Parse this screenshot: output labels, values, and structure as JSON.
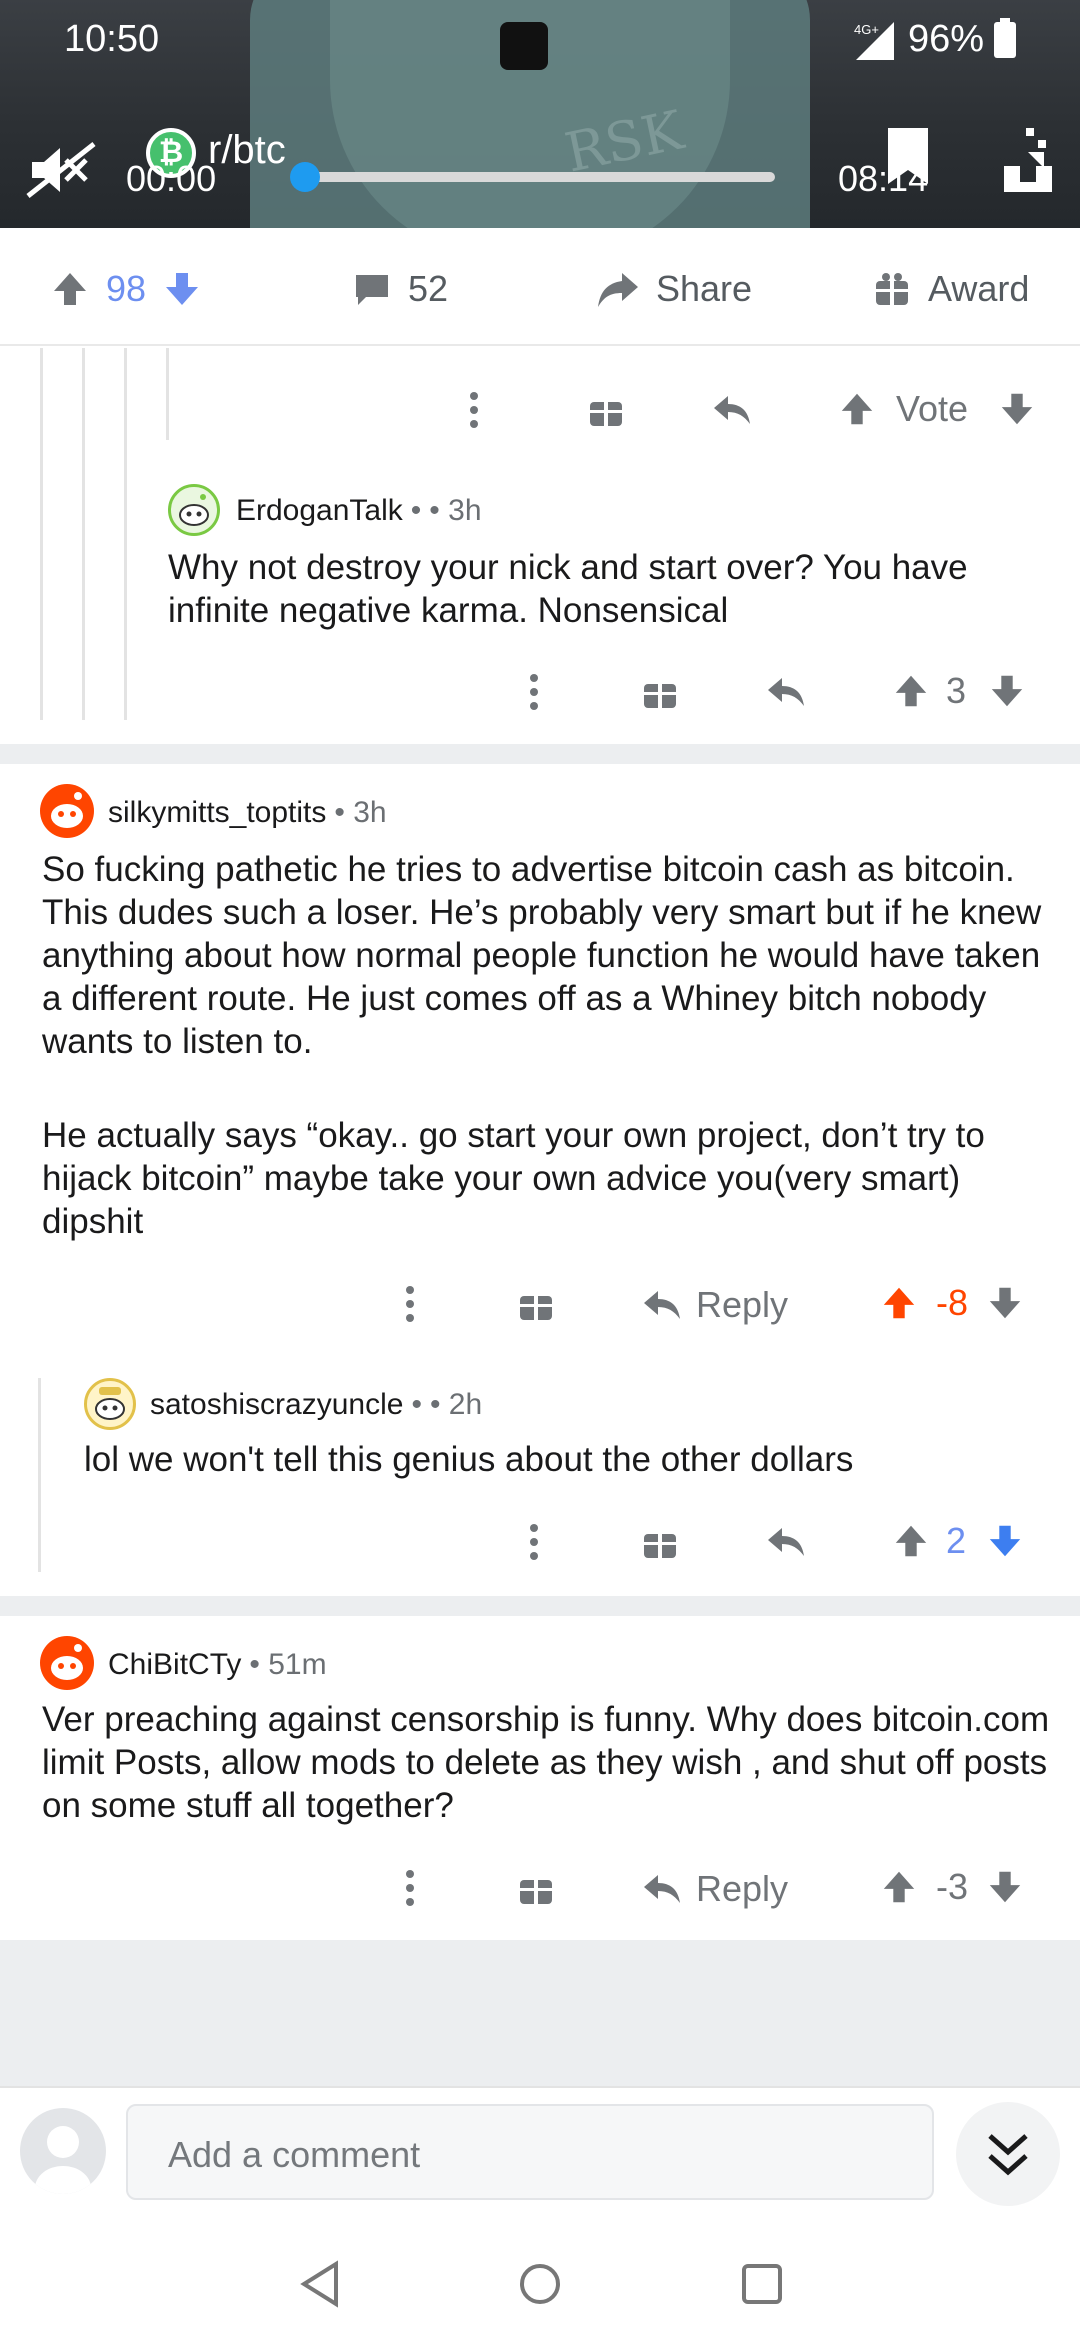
{
  "status_bar": {
    "time": "10:50",
    "network": "4G+",
    "battery": "96%"
  },
  "video": {
    "subreddit": "r/btc",
    "current_time": "00:00",
    "remaining_time": "08:14",
    "progress": 0.0,
    "watermark_text": "RSK"
  },
  "post_actions": {
    "upvotes": "98",
    "comments": "52",
    "share_label": "Share",
    "award_label": "Award"
  },
  "comments": [
    {
      "id": "c0",
      "actions": {
        "vote_label": "Vote"
      }
    },
    {
      "id": "c1",
      "author": "ErdoganTalk",
      "separator": "•",
      "time": "• 3h",
      "body": "Why not destroy your nick and start over? You have infinite negative karma. Nonsensical",
      "score": "3"
    },
    {
      "id": "c2",
      "author": "silkymitts_toptits",
      "time": "• 3h",
      "body_p1": "So fucking pathetic he tries to advertise bitcoin cash as bitcoin. This dudes such a loser. He’s probably very smart but if he knew anything about how normal people function he would have taken a different route. He just comes off as a Whiney bitch nobody wants to listen to.",
      "body_p2": "He actually says “okay.. go start your own project, don’t try to hijack bitcoin” maybe take your own advice you(very smart) dipshit",
      "reply_label": "Reply",
      "score": "-8",
      "vote_state": "upvoted"
    },
    {
      "id": "c3",
      "author": "satoshiscrazyuncle",
      "separator": "•",
      "time": "• 2h",
      "body": "lol we won't tell this genius about the other dollars",
      "score": "2",
      "vote_state": "downvoted"
    },
    {
      "id": "c4",
      "author": "ChiBitCTy",
      "time": "• 51m",
      "body": "Ver preaching against censorship is funny. Why does bitcoin.com limit Posts, allow mods to delete as they wish , and shut off posts on some stuff all together?",
      "reply_label": "Reply",
      "score": "-3"
    }
  ],
  "composer": {
    "placeholder": "Add a comment"
  },
  "colors": {
    "upvote": "#ff4500",
    "downvote": "#6d8ff0",
    "seek": "#1e9bf0"
  }
}
